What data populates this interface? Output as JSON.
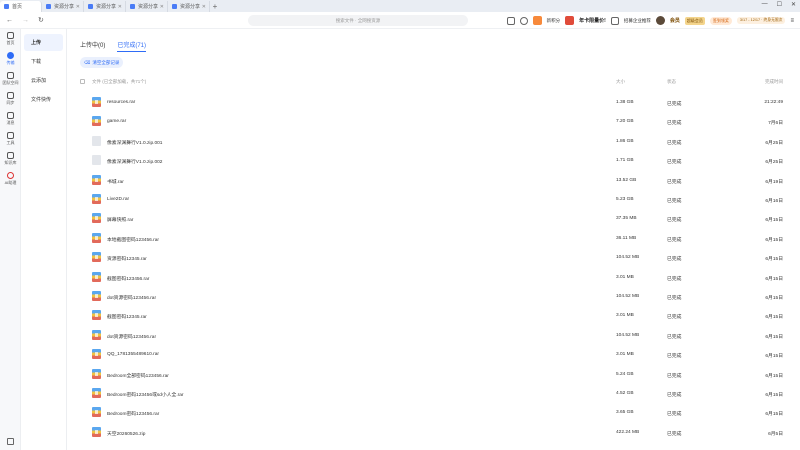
{
  "tabs": [
    {
      "label": "首页",
      "active": true
    },
    {
      "label": "资源分享",
      "active": false
    },
    {
      "label": "资源分享",
      "active": false
    },
    {
      "label": "资源分享",
      "active": false
    },
    {
      "label": "资源分享",
      "active": false
    }
  ],
  "tab_add": "+",
  "window_controls": [
    "—",
    "☐",
    "✕"
  ],
  "search": {
    "placeholder": "搜索文件 · 全网搜资源"
  },
  "header_right": {
    "points": "新积分",
    "ad": "年卡限量价!",
    "team": "招募企业推荐",
    "member": "会员",
    "badge": "超级会员",
    "gift": "签到领奖",
    "dates": "3/17 - 12/17 · 终身无限次"
  },
  "left_nav": [
    {
      "label": "首页",
      "icon": "home-icon"
    },
    {
      "label": "传输",
      "icon": "transfer-icon",
      "active": true
    },
    {
      "label": "团队空间",
      "icon": "team-icon"
    },
    {
      "label": "同步",
      "icon": "sync-icon"
    },
    {
      "label": "消息",
      "icon": "message-icon"
    },
    {
      "label": "工具",
      "icon": "tool-icon"
    },
    {
      "label": "知识库",
      "icon": "knowledge-icon"
    },
    {
      "label": "AI助理",
      "icon": "ai-icon"
    }
  ],
  "sub_nav": [
    {
      "label": "上传",
      "active": true
    },
    {
      "label": "下载"
    },
    {
      "label": "云添加"
    },
    {
      "label": "文件快传"
    }
  ],
  "main_tabs": [
    {
      "label": "上传中(0)"
    },
    {
      "label": "已完成(71)",
      "active": true
    }
  ],
  "clear_button": "清空全部记录",
  "table_header": {
    "name": "文件 (已全部加载，共71个)",
    "size": "大小",
    "status": "状态",
    "time": "完成时间"
  },
  "files": [
    {
      "name": "resources.rar",
      "size": "1.38 GB",
      "status": "已完成",
      "time": "21:22:49",
      "type": "rar"
    },
    {
      "name": "game.rar",
      "size": "7.20 GB",
      "status": "已完成",
      "time": "7月6日",
      "type": "rar"
    },
    {
      "name": "像素深渊舞行V1.0.zip.001",
      "size": "1.86 GB",
      "status": "已完成",
      "time": "6月25日",
      "type": "zip"
    },
    {
      "name": "像素深渊舞行V1.0.zip.002",
      "size": "1.71 GB",
      "status": "已完成",
      "time": "6月25日",
      "type": "zip"
    },
    {
      "name": "书城.rar",
      "size": "13.52 GB",
      "status": "已完成",
      "time": "6月19日",
      "type": "rar"
    },
    {
      "name": "Live2D.rar",
      "size": "5.23 GB",
      "status": "已完成",
      "time": "6月16日",
      "type": "rar"
    },
    {
      "name": "屏幕快照.rar",
      "size": "37.35 MB",
      "status": "已完成",
      "time": "6月15日",
      "type": "rar"
    },
    {
      "name": "本地截图密码123456.rar",
      "size": "36.11 MB",
      "status": "已完成",
      "time": "6月15日",
      "type": "rar"
    },
    {
      "name": "资源密码12345.rar",
      "size": "104.52 MB",
      "status": "已完成",
      "time": "6月15日",
      "type": "rar"
    },
    {
      "name": "截图密码123456.rar",
      "size": "3.01 MB",
      "status": "已完成",
      "time": "6月15日",
      "type": "rar"
    },
    {
      "name": "dot资源密码123456.rar",
      "size": "104.52 MB",
      "status": "已完成",
      "time": "6月15日",
      "type": "rar"
    },
    {
      "name": "截图密码12345.rar",
      "size": "3.01 MB",
      "status": "已完成",
      "time": "6月15日",
      "type": "rar"
    },
    {
      "name": "dot资源密码123456.rar",
      "size": "104.52 MB",
      "status": "已完成",
      "time": "6月15日",
      "type": "rar"
    },
    {
      "name": "QQ_1781355489610.rar",
      "size": "3.01 MB",
      "status": "已完成",
      "time": "6月15日",
      "type": "rar"
    },
    {
      "name": "Bedroom全部密码123456.rar",
      "size": "5.24 GB",
      "status": "已完成",
      "time": "6月15日",
      "type": "rar"
    },
    {
      "name": "Bedroom密码123456或sd小人全.rar",
      "size": "4.52 GB",
      "status": "已完成",
      "time": "6月15日",
      "type": "rar"
    },
    {
      "name": "Bedroom密码123456.rar",
      "size": "3.65 GB",
      "status": "已完成",
      "time": "6月15日",
      "type": "rar"
    },
    {
      "name": "天空20260526.zip",
      "size": "422.24 MB",
      "status": "已完成",
      "time": "6月5日",
      "type": "rar"
    }
  ]
}
